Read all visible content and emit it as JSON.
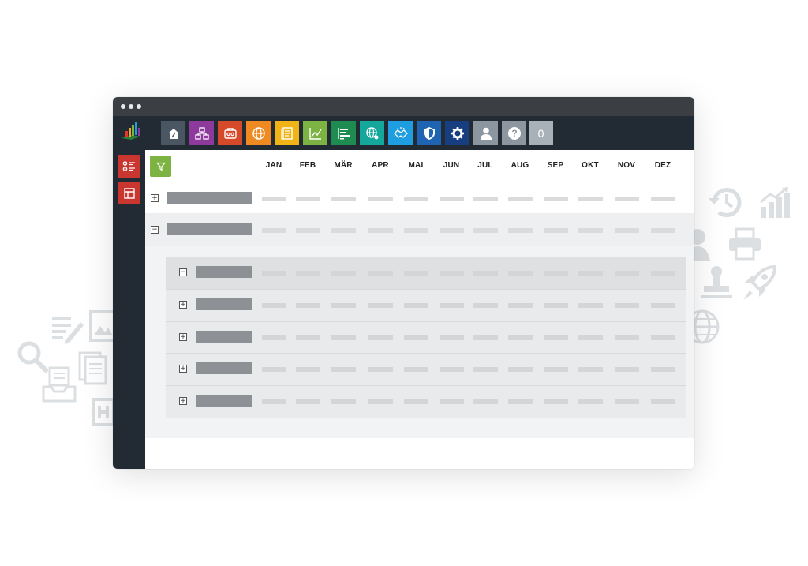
{
  "colors": {
    "titlebar": "#3b3f44",
    "toolbar": "#222b33",
    "sidebar_button": "#c8362f",
    "filter_button": "#7cb342",
    "placeholder_label": "#8d9196",
    "placeholder_cell": "#d9dbdd"
  },
  "window": {
    "traffic_lights": [
      "dot",
      "dot",
      "dot"
    ]
  },
  "toolbar": {
    "buttons": [
      {
        "icon": "home-icon",
        "color": "#4a5763"
      },
      {
        "icon": "org-chart-icon",
        "color": "#8e3a9d"
      },
      {
        "icon": "briefcase-icon",
        "color": "#d64a2a"
      },
      {
        "icon": "globe-icon",
        "color": "#ef8a22"
      },
      {
        "icon": "document-icon",
        "color": "#f1b416"
      },
      {
        "icon": "line-chart-icon",
        "color": "#7cb342"
      },
      {
        "icon": "gantt-icon",
        "color": "#1e8c50"
      },
      {
        "icon": "network-globe-icon",
        "color": "#14a79c"
      },
      {
        "icon": "handshake-icon",
        "color": "#1e9ee0"
      },
      {
        "icon": "shield-icon",
        "color": "#1f64b3"
      },
      {
        "icon": "gear-icon",
        "color": "#163e80"
      },
      {
        "icon": "user-icon",
        "color": "#8c96a0"
      },
      {
        "icon": "help-icon",
        "color": "#8c96a0"
      }
    ],
    "counter": "0"
  },
  "sidebar": {
    "items": [
      {
        "icon": "checklist-icon"
      },
      {
        "icon": "layout-icon"
      }
    ]
  },
  "grid": {
    "months": [
      "JAN",
      "FEB",
      "MÄR",
      "APR",
      "MAI",
      "JUN",
      "JUL",
      "AUG",
      "SEP",
      "OKT",
      "NOV",
      "DEZ"
    ],
    "rows": [
      {
        "toggle": "+",
        "level": 0
      },
      {
        "toggle": "−",
        "level": 0
      },
      {
        "toggle": "−",
        "level": 1
      },
      {
        "toggle": "+",
        "level": 1
      },
      {
        "toggle": "+",
        "level": 1
      },
      {
        "toggle": "+",
        "level": 1
      },
      {
        "toggle": "+",
        "level": 1
      }
    ]
  }
}
